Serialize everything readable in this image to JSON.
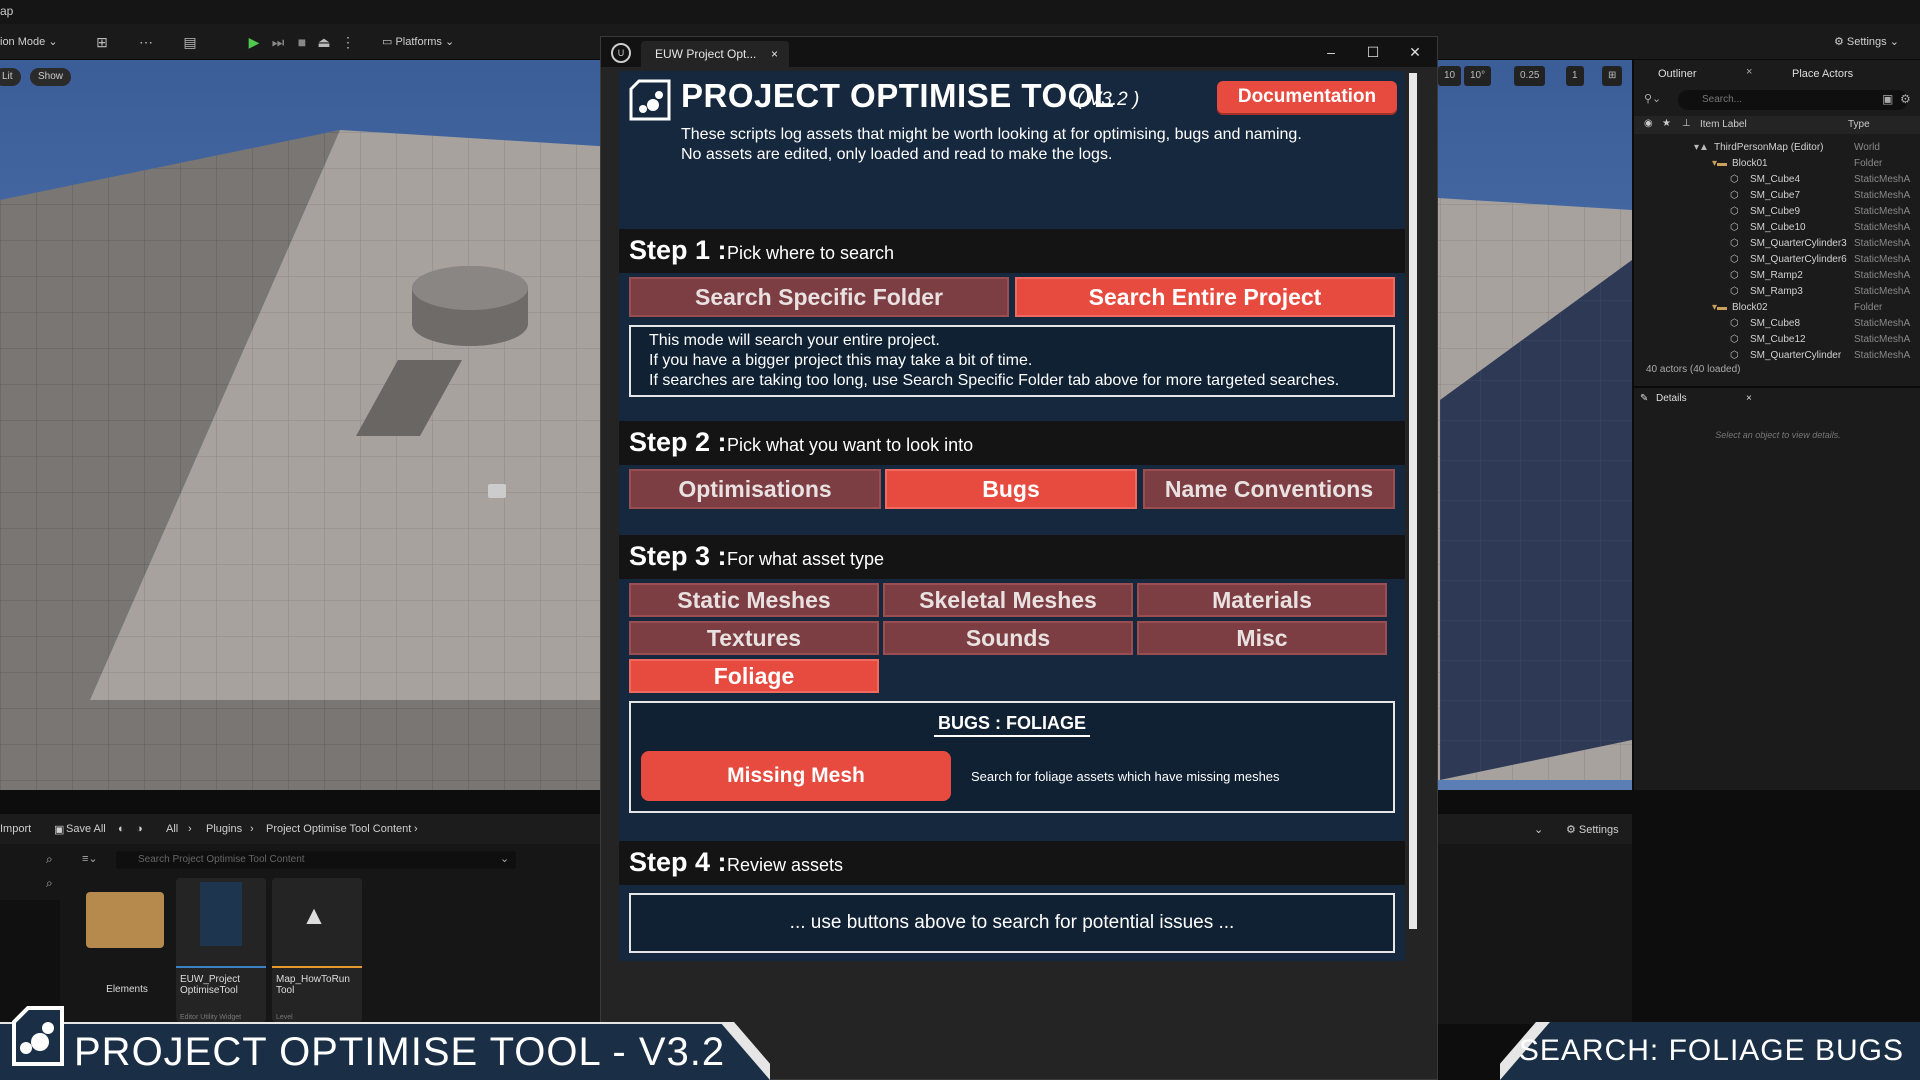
{
  "menubar": {
    "fragment": "ap"
  },
  "toolbar": {
    "mode_label": "ion Mode",
    "platforms_label": "Platforms",
    "settings_label": "Settings"
  },
  "viewport": {
    "lit_label": "Lit",
    "show_label": "Show",
    "chips": [
      "10",
      "10°",
      "0.25",
      "1"
    ]
  },
  "outliner": {
    "tab_label": "Outliner",
    "place_actors_label": "Place Actors",
    "search_placeholder": "Search...",
    "col_label": "Item Label",
    "col_type": "Type",
    "rows": [
      {
        "label": "ThirdPersonMap (Editor)",
        "type": "World",
        "indent": 0,
        "kind": "world"
      },
      {
        "label": "Block01",
        "type": "Folder",
        "indent": 1,
        "kind": "folder"
      },
      {
        "label": "SM_Cube4",
        "type": "StaticMeshA",
        "indent": 2,
        "kind": "mesh"
      },
      {
        "label": "SM_Cube7",
        "type": "StaticMeshA",
        "indent": 2,
        "kind": "mesh"
      },
      {
        "label": "SM_Cube9",
        "type": "StaticMeshA",
        "indent": 2,
        "kind": "mesh"
      },
      {
        "label": "SM_Cube10",
        "type": "StaticMeshA",
        "indent": 2,
        "kind": "mesh"
      },
      {
        "label": "SM_QuarterCylinder3",
        "type": "StaticMeshA",
        "indent": 2,
        "kind": "mesh"
      },
      {
        "label": "SM_QuarterCylinder6",
        "type": "StaticMeshA",
        "indent": 2,
        "kind": "mesh"
      },
      {
        "label": "SM_Ramp2",
        "type": "StaticMeshA",
        "indent": 2,
        "kind": "mesh"
      },
      {
        "label": "SM_Ramp3",
        "type": "StaticMeshA",
        "indent": 2,
        "kind": "mesh"
      },
      {
        "label": "Block02",
        "type": "Folder",
        "indent": 1,
        "kind": "folder"
      },
      {
        "label": "SM_Cube8",
        "type": "StaticMeshA",
        "indent": 2,
        "kind": "mesh"
      },
      {
        "label": "SM_Cube12",
        "type": "StaticMeshA",
        "indent": 2,
        "kind": "mesh"
      },
      {
        "label": "SM_QuarterCylinder",
        "type": "StaticMeshA",
        "indent": 2,
        "kind": "mesh"
      }
    ],
    "count": "40 actors (40 loaded)",
    "details_label": "Details",
    "details_hint": "Select an object to view details."
  },
  "content_browser": {
    "import_label": "Import",
    "save_all_label": "Save All",
    "breadcrumb": [
      "All",
      "Plugins",
      "Project Optimise Tool Content"
    ],
    "settings_label": "Settings",
    "search_placeholder": "Search Project Optimise Tool Content",
    "assets": [
      {
        "label": "Elements",
        "sub": ""
      },
      {
        "label": "EUW_Project OptimiseTool",
        "sub": "Editor Utility Widget"
      },
      {
        "label": "Map_HowToRun Tool",
        "sub": "Level"
      }
    ]
  },
  "euw": {
    "tab_title": "EUW Project Opt...",
    "header": {
      "title": "PROJECT OPTIMISE TOOL",
      "version": "( V3.2 )",
      "docs_button": "Documentation",
      "desc_line1": "These scripts log assets that might be worth looking at for optimising, bugs and naming.",
      "desc_line2": "No assets are edited, only loaded and read to make the logs."
    },
    "step1": {
      "num": "Step 1 :",
      "title": "Pick where to search",
      "buttons": [
        "Search Specific Folder",
        "Search Entire Project"
      ],
      "info_line1": "This mode will search your entire project.",
      "info_line2": "If you have a bigger project this may take a bit of time.",
      "info_line3": "If searches are taking too long, use Search Specific Folder tab above for more targeted searches."
    },
    "step2": {
      "num": "Step 2 :",
      "title": "Pick what you want to look into",
      "buttons": [
        "Optimisations",
        "Bugs",
        "Name Conventions"
      ]
    },
    "step3": {
      "num": "Step 3 :",
      "title": "For what asset type",
      "buttons": [
        "Static Meshes",
        "Skeletal Meshes",
        "Materials",
        "Textures",
        "Sounds",
        "Misc",
        "Foliage"
      ],
      "box_title": "BUGS : FOLIAGE",
      "action_button": "Missing Mesh",
      "action_desc": "Search for foliage assets which have missing meshes"
    },
    "step4": {
      "num": "Step 4 :",
      "title": "Review assets",
      "placeholder": "... use buttons above to search for potential issues ..."
    }
  },
  "banner": {
    "title": "PROJECT OPTIMISE TOOL  -  V3.2",
    "subtitle": "SEARCH: FOLIAGE BUGS"
  },
  "colors": {
    "accent_red": "#e74a3f",
    "muted_red": "#7c3e42",
    "panel_navy": "#16283d",
    "banner_navy": "#1a2f45"
  }
}
